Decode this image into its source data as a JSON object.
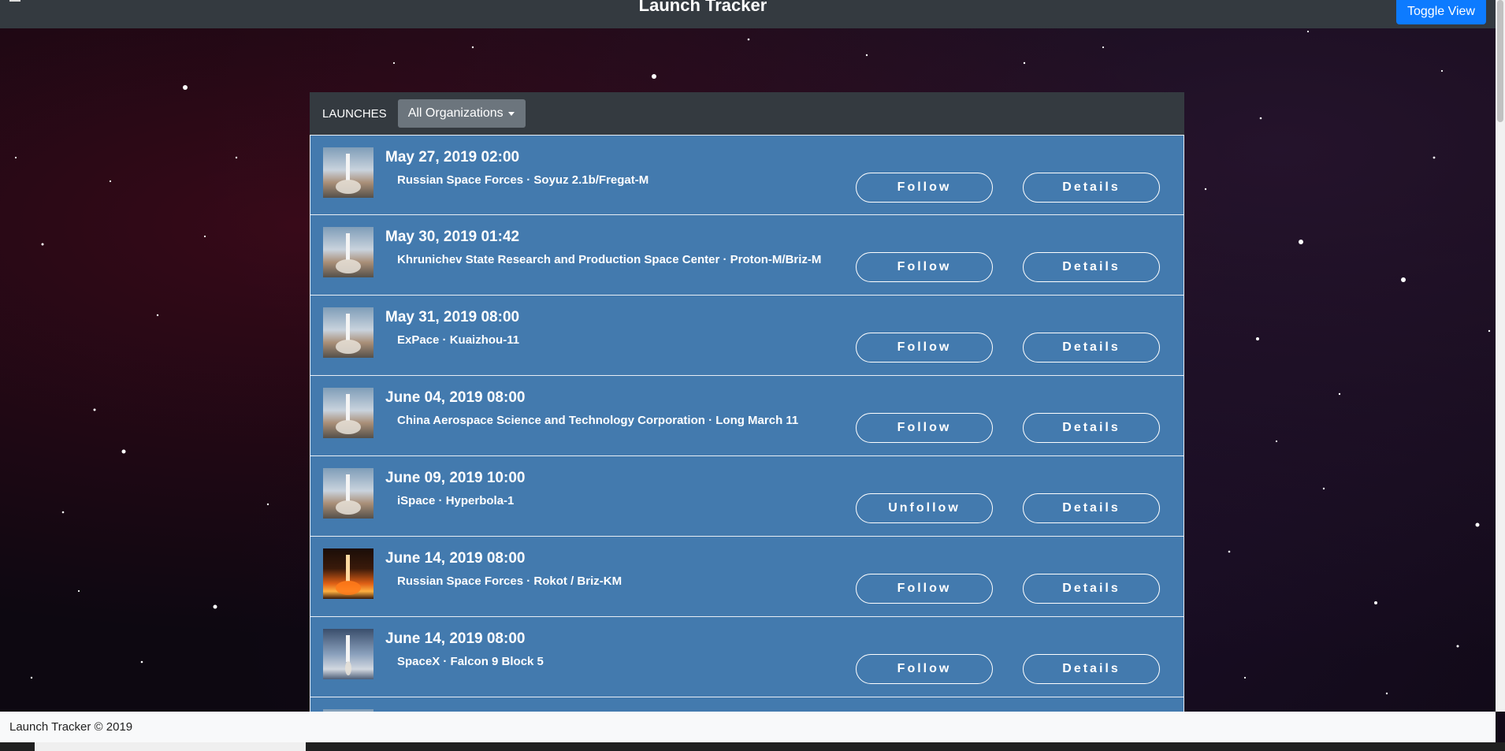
{
  "navbar": {
    "brand": "Launch Tracker",
    "toggle_label": "Toggle View"
  },
  "panel": {
    "title": "LAUNCHES",
    "filter_label": "All Organizations"
  },
  "launches": [
    {
      "date": "May 27, 2019 02:00",
      "info": "Russian Space Forces · Soyuz 2.1b/Fregat-M",
      "follow_label": "Follow",
      "details_label": "Details",
      "thumb": "rocket"
    },
    {
      "date": "May 30, 2019 01:42",
      "info": "Khrunichev State Research and Production Space Center · Proton-M/Briz-M",
      "follow_label": "Follow",
      "details_label": "Details",
      "thumb": "rocket"
    },
    {
      "date": "May 31, 2019 08:00",
      "info": "ExPace · Kuaizhou-11",
      "follow_label": "Follow",
      "details_label": "Details",
      "thumb": "rocket"
    },
    {
      "date": "June 04, 2019 08:00",
      "info": "China Aerospace Science and Technology Corporation · Long March 11",
      "follow_label": "Follow",
      "details_label": "Details",
      "thumb": "rocket"
    },
    {
      "date": "June 09, 2019 10:00",
      "info": "iSpace · Hyperbola-1",
      "follow_label": "Unfollow",
      "details_label": "Details",
      "thumb": "rocket"
    },
    {
      "date": "June 14, 2019 08:00",
      "info": "Russian Space Forces · Rokot / Briz-KM",
      "follow_label": "Follow",
      "details_label": "Details",
      "thumb": "fire"
    },
    {
      "date": "June 14, 2019 08:00",
      "info": "SpaceX · Falcon 9 Block 5",
      "follow_label": "Follow",
      "details_label": "Details",
      "thumb": "falcon"
    },
    {
      "date": "",
      "info": "",
      "follow_label": "",
      "details_label": "",
      "thumb": "rocket"
    }
  ],
  "footer": {
    "text": "Launch Tracker © 2019"
  },
  "colors": {
    "navbar": "#343a40",
    "list_item": "#437aae",
    "toggle_button": "#0d7bff",
    "dropdown": "#6c757d"
  }
}
